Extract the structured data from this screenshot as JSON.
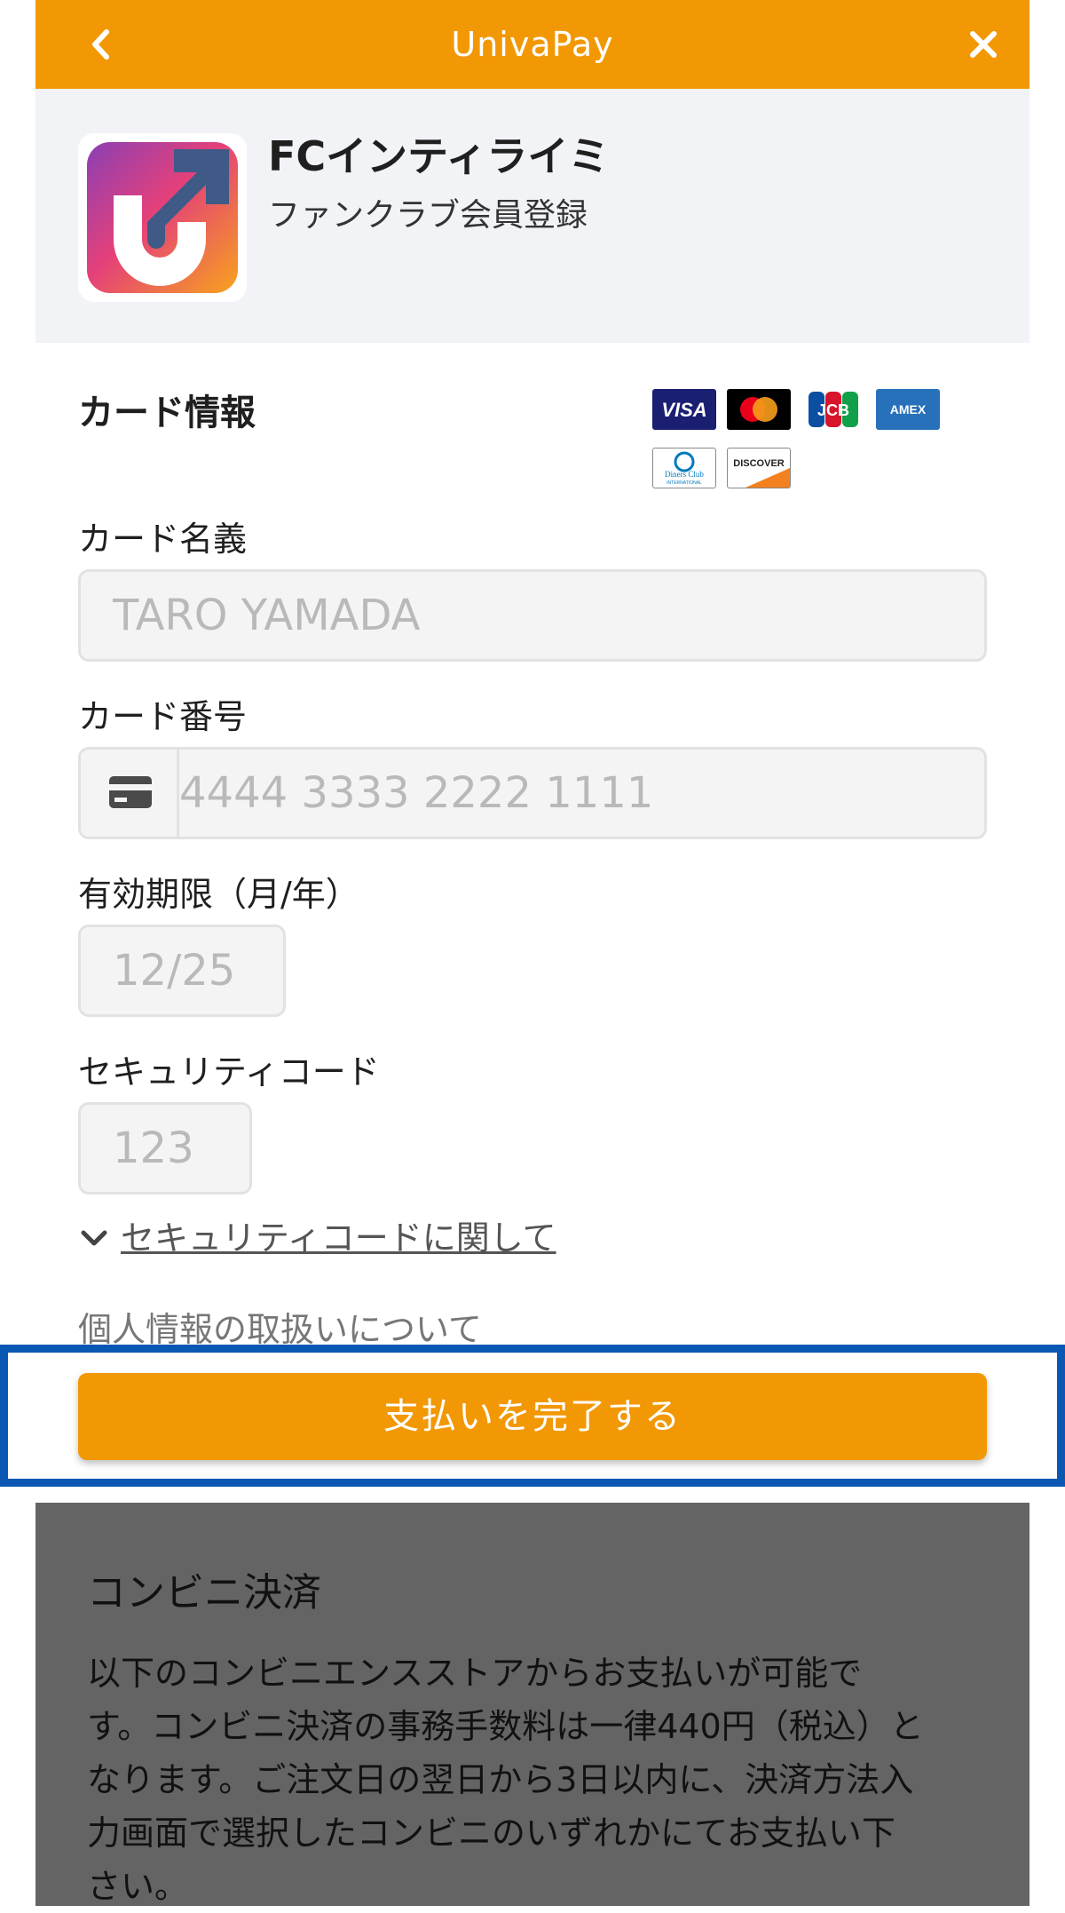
{
  "header": {
    "title": "UnivaPay",
    "back_icon": "chevron-left-icon",
    "close_icon": "close-icon",
    "color": "#f29805"
  },
  "merchant": {
    "name": "FCインティライミ",
    "description": "ファンクラブ会員登録",
    "logo_icon": "univapay-logo-icon"
  },
  "card_section": {
    "title": "カード情報",
    "brands": [
      "VISA",
      "Mastercard",
      "JCB",
      "AMEX",
      "Diners Club",
      "DISCOVER"
    ],
    "cardholder": {
      "label": "カード名義",
      "placeholder": "TARO YAMADA"
    },
    "number": {
      "label": "カード番号",
      "placeholder": "4444 3333 2222 1111",
      "icon": "credit-card-icon"
    },
    "expiry": {
      "label": "有効期限（月/年）",
      "placeholder": "12/25"
    },
    "cvv": {
      "label": "セキュリティコード",
      "placeholder": "123"
    },
    "cvv_help": "セキュリティコードに関して",
    "privacy": "個人情報の取扱いについて"
  },
  "pay_button": {
    "label": "支払いを完了する"
  },
  "konbini": {
    "title": "コンビニ決済",
    "lines": [
      "以下のコンビニエンスストアからお支払いが可能で",
      "す。コンビニ決済の事務手数料は一律440円（税込）と",
      "なります。ご注文日の翌日から3日以内に、決済方法入",
      "力画面で選択したコンビニのいずれかにてお支払い下",
      "さい。"
    ]
  }
}
